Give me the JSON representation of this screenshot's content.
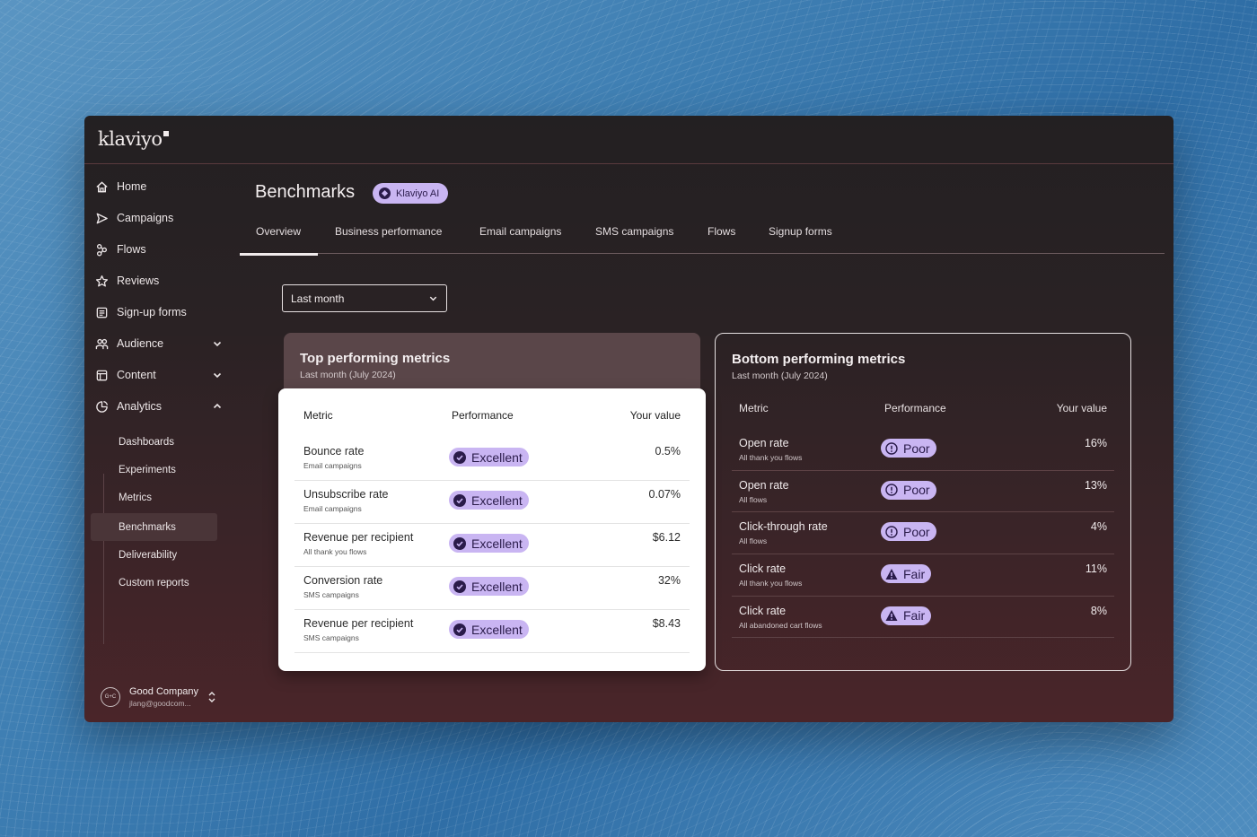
{
  "app": {
    "logo": "klaviyo"
  },
  "sidebar": {
    "items": [
      {
        "label": "Home",
        "icon": "home-icon"
      },
      {
        "label": "Campaigns",
        "icon": "send-icon"
      },
      {
        "label": "Flows",
        "icon": "flows-icon"
      },
      {
        "label": "Reviews",
        "icon": "star-icon"
      },
      {
        "label": "Sign-up forms",
        "icon": "form-icon"
      },
      {
        "label": "Audience",
        "icon": "people-icon",
        "chevron": "down"
      },
      {
        "label": "Content",
        "icon": "content-icon",
        "chevron": "down"
      },
      {
        "label": "Analytics",
        "icon": "analytics-icon",
        "chevron": "up"
      }
    ],
    "analytics_subitems": [
      {
        "label": "Dashboards"
      },
      {
        "label": "Experiments"
      },
      {
        "label": "Metrics"
      },
      {
        "label": "Benchmarks",
        "active": true
      },
      {
        "label": "Deliverability"
      },
      {
        "label": "Custom reports"
      }
    ],
    "account": {
      "avatar": "G+C",
      "name": "Good Company",
      "email": "jlang@goodcom..."
    }
  },
  "header": {
    "title": "Benchmarks",
    "ai_badge": "Klaviyo AI",
    "tabs": [
      {
        "label": "Overview",
        "active": true
      },
      {
        "label": "Business performance"
      },
      {
        "label": "Email campaigns"
      },
      {
        "label": "SMS campaigns"
      },
      {
        "label": "Flows"
      },
      {
        "label": "Signup forms"
      }
    ]
  },
  "filter": {
    "selected": "Last month"
  },
  "top_card": {
    "title": "Top performing metrics",
    "subtitle": "Last month (July 2024)",
    "columns": [
      "Metric",
      "Performance",
      "Your value"
    ],
    "rows": [
      {
        "metric": "Bounce rate",
        "source": "Email campaigns",
        "performance": "Excellent",
        "value": "0.5%"
      },
      {
        "metric": "Unsubscribe rate",
        "source": "Email campaigns",
        "performance": "Excellent",
        "value": "0.07%"
      },
      {
        "metric": "Revenue per recipient",
        "source": "All thank you flows",
        "performance": "Excellent",
        "value": "$6.12"
      },
      {
        "metric": "Conversion rate",
        "source": "SMS campaigns",
        "performance": "Excellent",
        "value": "32%"
      },
      {
        "metric": "Revenue per recipient",
        "source": "SMS campaigns",
        "performance": "Excellent",
        "value": "$8.43"
      }
    ]
  },
  "bottom_card": {
    "title": "Bottom performing metrics",
    "subtitle": "Last month (July 2024)",
    "columns": [
      "Metric",
      "Performance",
      "Your value"
    ],
    "rows": [
      {
        "metric": "Open rate",
        "source": "All thank you flows",
        "performance": "Poor",
        "value": "16%"
      },
      {
        "metric": "Open rate",
        "source": "All flows",
        "performance": "Poor",
        "value": "13%"
      },
      {
        "metric": "Click-through rate",
        "source": "All flows",
        "performance": "Poor",
        "value": "4%"
      },
      {
        "metric": "Click rate",
        "source": "All thank you flows",
        "performance": "Fair",
        "value": "11%"
      },
      {
        "metric": "Click rate",
        "source": "All abandoned cart flows",
        "performance": "Fair",
        "value": "8%"
      }
    ]
  },
  "colors": {
    "badge_bg": "#c9b5f2",
    "badge_text": "#2a1b4a",
    "window_bg": "#2a2224"
  }
}
